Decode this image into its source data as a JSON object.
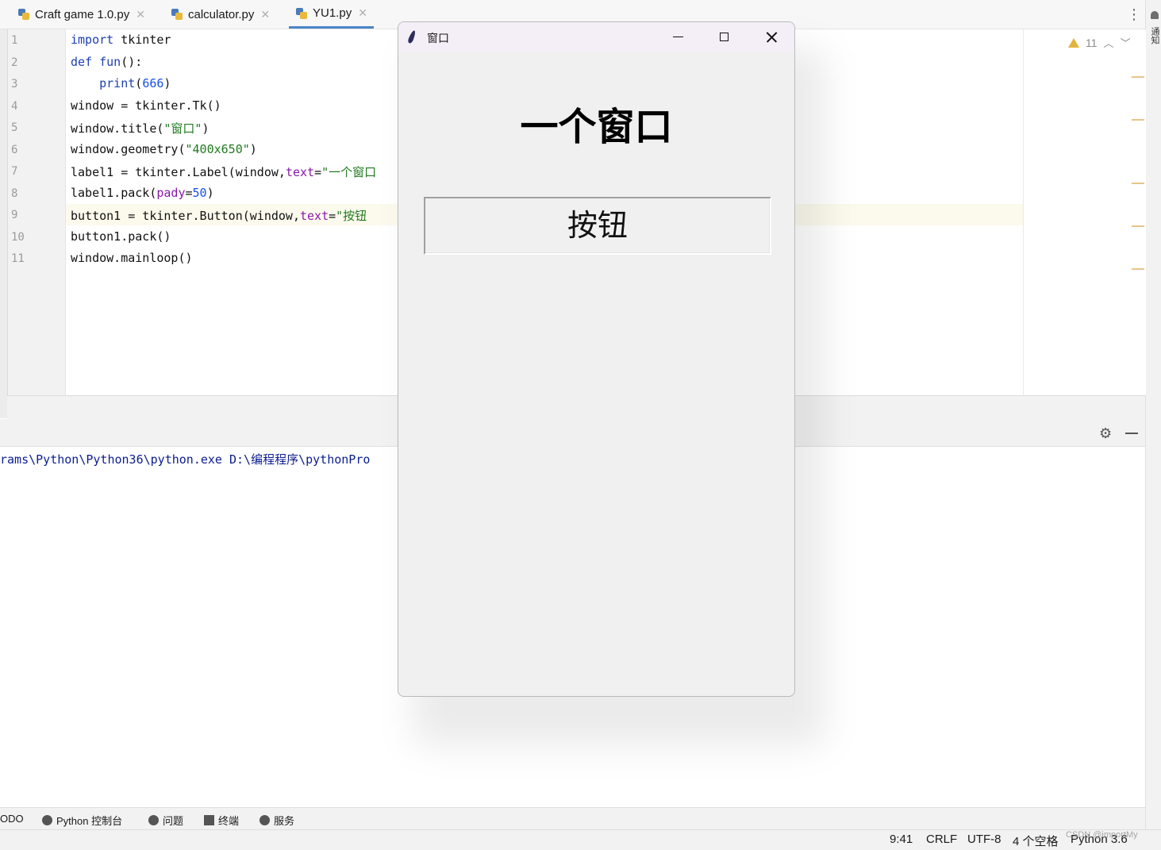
{
  "tabs": [
    {
      "label": "Craft game 1.0.py",
      "icon": "python-file-icon",
      "active": false
    },
    {
      "label": "calculator.py",
      "icon": "python-file-icon",
      "active": false
    },
    {
      "label": "YU1.py",
      "icon": "python-file-icon",
      "active": true
    }
  ],
  "tab_close_glyph": "✕",
  "editor": {
    "line_numbers": [
      "1",
      "2",
      "3",
      "4",
      "5",
      "6",
      "7",
      "8",
      "9",
      "10",
      "11"
    ],
    "current_line": "9",
    "warnings_count": "11",
    "lines": {
      "l1_kw": "import",
      "l1_rest": " tkinter",
      "l2_kw": "def",
      "l2_fn": " fun",
      "l2_rest": "():",
      "l3_indent": "    ",
      "l3_fn": "print",
      "l3_p1": "(",
      "l3_num": "666",
      "l3_p2": ")",
      "l4": "window = tkinter.Tk()",
      "l5_a": "window.title(",
      "l5_str": "\"窗口\"",
      "l5_b": ")",
      "l6_a": "window.geometry(",
      "l6_str": "\"400x650\"",
      "l6_b": ")",
      "l7_a": "label1 = tkinter.Label(window,",
      "l7_par": "text",
      "l7_eq": "=",
      "l7_str": "\"一个窗口",
      "l8_a": "label1.pack(",
      "l8_par": "pady",
      "l8_eq": "=",
      "l8_num": "50",
      "l8_b": ")",
      "l9_a": "button1 = tkinter.Button(window,",
      "l9_par": "text",
      "l9_eq": "=",
      "l9_str": "\"按钮",
      "l10": "button1.pack()",
      "l11": "window.mainloop()"
    }
  },
  "run_output": "rams\\Python\\Python36\\python.exe D:\\编程程序\\pythonPro",
  "tool_windows": [
    {
      "label": "ODO",
      "icon": "todo-icon"
    },
    {
      "label": "Python 控制台",
      "icon": "python-console-icon"
    },
    {
      "label": "问题",
      "icon": "problems-icon"
    },
    {
      "label": "终端",
      "icon": "terminal-icon"
    },
    {
      "label": "服务",
      "icon": "services-icon"
    }
  ],
  "status": {
    "position": "9:41",
    "line_ending": "CRLF",
    "encoding": "UTF-8",
    "indent": "4 个空格",
    "interpreter": "Python 3.6"
  },
  "notification_label": "通知",
  "watermark": "CSDN @importMy",
  "tk_window": {
    "title": "窗口",
    "label_text": "一个窗口",
    "button_text": "按钮"
  },
  "colors": {
    "accent_tab": "#4b86c9",
    "keyword": "#1d3fb0",
    "string": "#1f7a1f",
    "param": "#8a1aa8",
    "warning": "#e2b33d"
  }
}
